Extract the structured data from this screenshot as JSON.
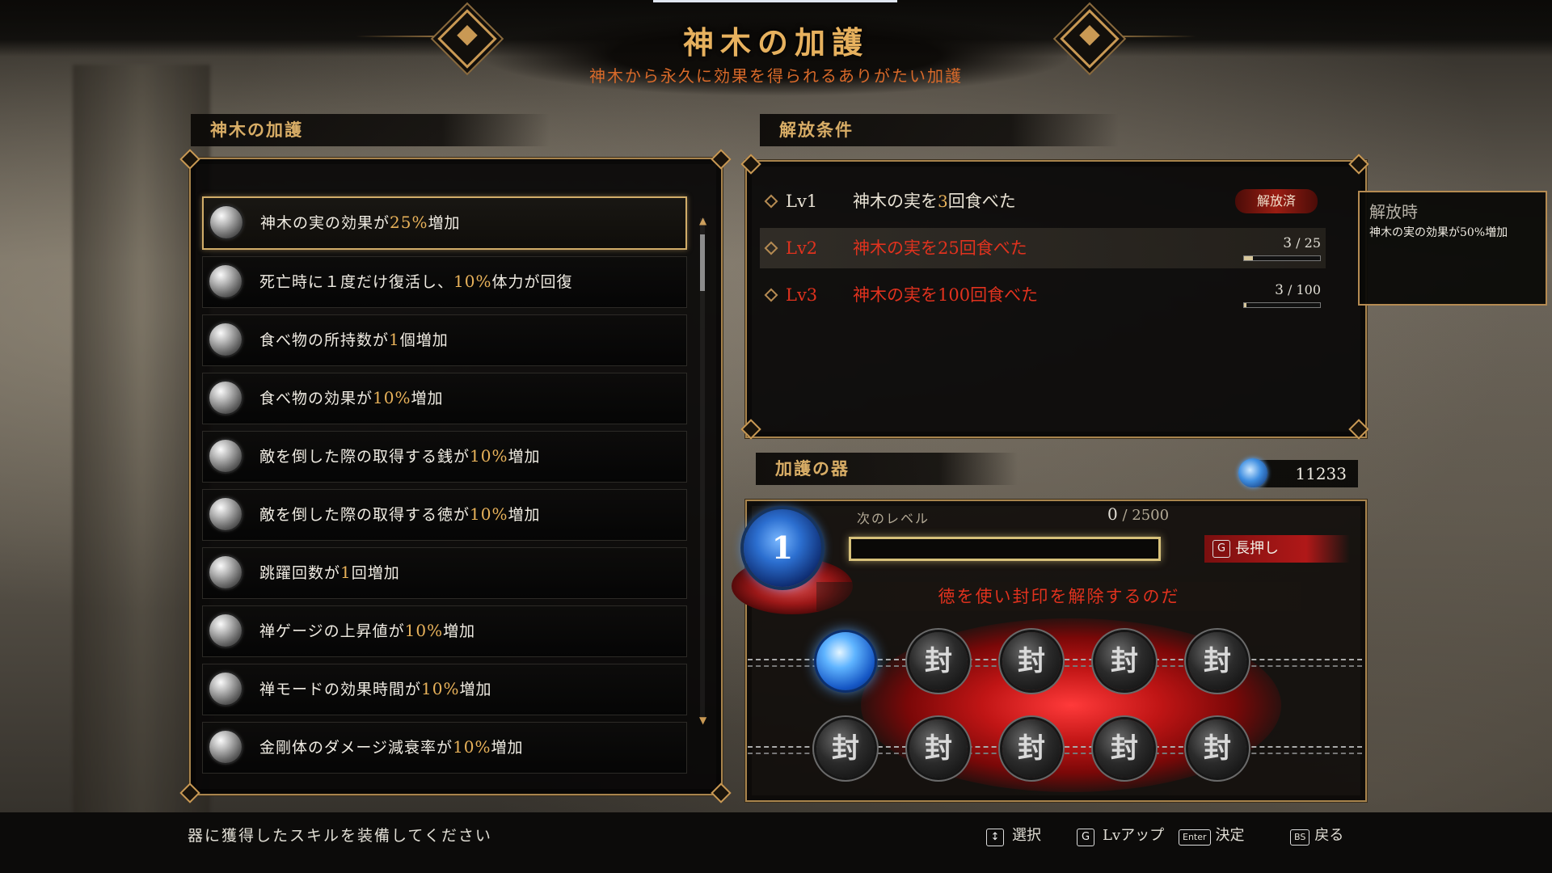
{
  "header": {
    "title": "神木の加護",
    "subtitle": "神木から永久に効果を得られるありがたい加護"
  },
  "left_panel": {
    "heading": "神木の加護",
    "items": [
      {
        "pre": "神木の実の効果が",
        "num": "25%",
        "post": "増加",
        "selected": true
      },
      {
        "pre": "死亡時に１度だけ復活し、",
        "num": "10%",
        "post": "体力が回復",
        "selected": false
      },
      {
        "pre": "食べ物の所持数が",
        "num": "1",
        "post": "個増加",
        "selected": false
      },
      {
        "pre": "食べ物の効果が",
        "num": "10%",
        "post": "増加",
        "selected": false
      },
      {
        "pre": "敵を倒した際の取得する銭が",
        "num": "10%",
        "post": "増加",
        "selected": false
      },
      {
        "pre": "敵を倒した際の取得する徳が",
        "num": "10%",
        "post": "増加",
        "selected": false
      },
      {
        "pre": "跳躍回数が",
        "num": "1",
        "post": "回増加",
        "selected": false
      },
      {
        "pre": "禅ゲージの上昇値が",
        "num": "10%",
        "post": "増加",
        "selected": false
      },
      {
        "pre": "禅モードの効果時間が",
        "num": "10%",
        "post": "増加",
        "selected": false
      },
      {
        "pre": "金剛体のダメージ減衰率が",
        "num": "10%",
        "post": "増加",
        "selected": false
      }
    ]
  },
  "conditions": {
    "heading": "解放条件",
    "rows": [
      {
        "level": "Lv1",
        "pre": "神木の実を",
        "num": "3",
        "post": "回食べた",
        "status": "解放済",
        "progress": null
      },
      {
        "level": "Lv2",
        "pre": "神木の実を",
        "num": "25",
        "post": "回食べた",
        "status": null,
        "current": "3",
        "total": "25",
        "progress": 0.12
      },
      {
        "level": "Lv3",
        "pre": "神木の実を",
        "num": "100",
        "post": "回食べた",
        "status": null,
        "current": "3",
        "total": "100",
        "progress": 0.03
      }
    ]
  },
  "tooltip": {
    "title": "解放時",
    "text": "神木の実の効果が50%増加"
  },
  "vessel": {
    "heading": "加護の器",
    "currency": "11233",
    "level": "1",
    "next_label": "次のレベル",
    "next_current": "0",
    "next_total": "2500",
    "next_progress": 0,
    "hold_key": "G",
    "hold_label": "長押し",
    "seal_message": "徳を使い封印を解除するのだ",
    "seal_char": "封"
  },
  "footer": {
    "hint": "器に獲得したスキルを装備してください",
    "controls": {
      "select_key": "↕",
      "select_label": "選択",
      "lvup_key": "G",
      "lvup_label": "Lvアップ",
      "confirm_key": "Enter",
      "confirm_label": "決定",
      "back_key": "BS",
      "back_label": "戻る"
    }
  },
  "colors": {
    "gold": "#d8ad66",
    "accent_orange": "#e7b15e",
    "red_text": "#e0321e",
    "frame": "#a8844d"
  }
}
